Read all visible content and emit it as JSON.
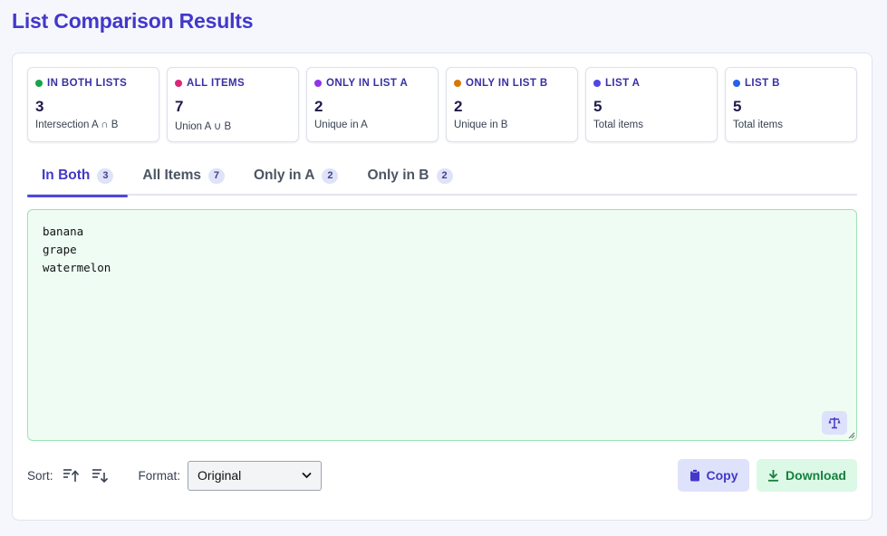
{
  "page": {
    "title": "List Comparison Results"
  },
  "stats": [
    {
      "label": "IN BOTH LISTS",
      "value": "3",
      "sub": "Intersection A ∩ B",
      "color": "#16a34a"
    },
    {
      "label": "ALL ITEMS",
      "value": "7",
      "sub": "Union A ∪ B",
      "color": "#db2777"
    },
    {
      "label": "ONLY IN LIST A",
      "value": "2",
      "sub": "Unique in A",
      "color": "#9333ea"
    },
    {
      "label": "ONLY IN LIST B",
      "value": "2",
      "sub": "Unique in B",
      "color": "#d97706"
    },
    {
      "label": "LIST A",
      "value": "5",
      "sub": "Total items",
      "color": "#4f46e5"
    },
    {
      "label": "LIST B",
      "value": "5",
      "sub": "Total items",
      "color": "#2563eb"
    }
  ],
  "tabs": [
    {
      "label": "In Both",
      "count": "3",
      "active": true
    },
    {
      "label": "All Items",
      "count": "7",
      "active": false
    },
    {
      "label": "Only in A",
      "count": "2",
      "active": false
    },
    {
      "label": "Only in B",
      "count": "2",
      "active": false
    }
  ],
  "results": {
    "items": [
      "banana",
      "grape",
      "watermelon"
    ]
  },
  "toolbar": {
    "sort_label": "Sort:",
    "format_label": "Format:",
    "format_value": "Original",
    "copy_label": "Copy",
    "download_label": "Download"
  },
  "icons": {
    "sort_asc": "sort-ascending-icon",
    "sort_desc": "sort-descending-icon",
    "copy": "clipboard-icon",
    "download": "download-icon",
    "compare": "scale-icon"
  }
}
